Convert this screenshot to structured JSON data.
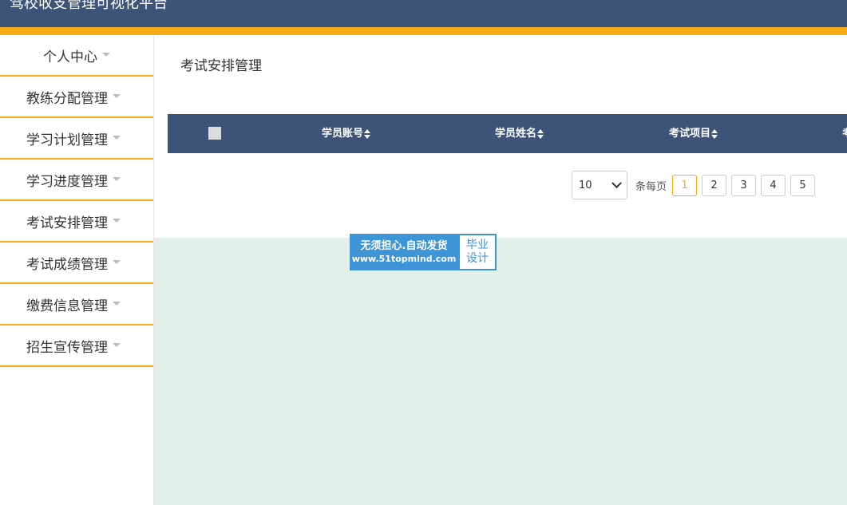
{
  "app": {
    "title": "驾校收支管理可视化平台"
  },
  "colors": {
    "header": "#3d5478",
    "accent": "#f7ab14",
    "background": "#e3f0ea"
  },
  "sidebar": {
    "items": [
      {
        "label": "个人中心",
        "icon": "caret-down-icon"
      },
      {
        "label": "教练分配管理",
        "icon": "caret-down-icon"
      },
      {
        "label": "学习计划管理",
        "icon": "caret-down-icon"
      },
      {
        "label": "学习进度管理",
        "icon": "caret-down-icon"
      },
      {
        "label": "考试安排管理",
        "icon": "caret-down-icon"
      },
      {
        "label": "考试成绩管理",
        "icon": "caret-down-icon"
      },
      {
        "label": "缴费信息管理",
        "icon": "caret-down-icon"
      },
      {
        "label": "招生宣传管理",
        "icon": "caret-down-icon"
      }
    ]
  },
  "main": {
    "title": "考试安排管理",
    "table": {
      "columns": [
        {
          "label": "学员账号",
          "icon": "sort-icon"
        },
        {
          "label": "学员姓名",
          "icon": "sort-icon"
        },
        {
          "label": "考试项目",
          "icon": "sort-icon"
        },
        {
          "label": "考",
          "icon": "sort-icon"
        }
      ]
    },
    "pagination": {
      "page_size": "10",
      "per_page_label": "条每页",
      "pages": [
        "1",
        "2",
        "3",
        "4",
        "5"
      ],
      "current": "1"
    }
  },
  "watermark": {
    "line1": "无须担心.自动发货",
    "line2": "www.51topmind.com",
    "badge_line1": "毕业",
    "badge_line2": "设计"
  }
}
